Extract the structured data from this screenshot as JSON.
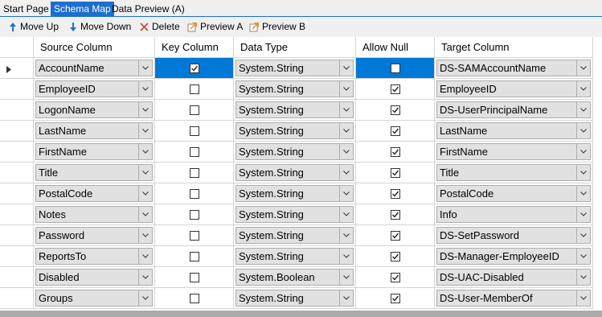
{
  "tabs": [
    {
      "label": "Start Page",
      "active": false
    },
    {
      "label": "Schema Map",
      "active": true
    },
    {
      "label": "Data Preview (A)",
      "active": false
    }
  ],
  "toolbar": [
    {
      "label": "Move Up",
      "icon": "arrow-up-icon",
      "color": "#1e73c8"
    },
    {
      "label": "Move Down",
      "icon": "arrow-down-icon",
      "color": "#1e73c8"
    },
    {
      "label": "Delete",
      "icon": "close-icon",
      "color": "#d83b3b"
    },
    {
      "label": "Preview A",
      "icon": "preview-icon",
      "color": "#e8932a"
    },
    {
      "label": "Preview B",
      "icon": "preview-icon",
      "color": "#e8932a"
    }
  ],
  "columns": [
    "Source Column",
    "Key Column",
    "Data Type",
    "Allow Null",
    "Target Column"
  ],
  "rows": [
    {
      "source": "AccountName",
      "key": true,
      "type": "System.String",
      "nullable": false,
      "target": "DS-SAMAccountName",
      "current": true
    },
    {
      "source": "EmployeeID",
      "key": false,
      "type": "System.String",
      "nullable": true,
      "target": "EmployeeID"
    },
    {
      "source": "LogonName",
      "key": false,
      "type": "System.String",
      "nullable": true,
      "target": "DS-UserPrincipalName"
    },
    {
      "source": "LastName",
      "key": false,
      "type": "System.String",
      "nullable": true,
      "target": "LastName"
    },
    {
      "source": "FirstName",
      "key": false,
      "type": "System.String",
      "nullable": true,
      "target": "FirstName"
    },
    {
      "source": "Title",
      "key": false,
      "type": "System.String",
      "nullable": true,
      "target": "Title"
    },
    {
      "source": "PostalCode",
      "key": false,
      "type": "System.String",
      "nullable": true,
      "target": "PostalCode"
    },
    {
      "source": "Notes",
      "key": false,
      "type": "System.String",
      "nullable": true,
      "target": "Info"
    },
    {
      "source": "Password",
      "key": false,
      "type": "System.String",
      "nullable": true,
      "target": "DS-SetPassword"
    },
    {
      "source": "ReportsTo",
      "key": false,
      "type": "System.String",
      "nullable": true,
      "target": "DS-Manager-EmployeeID"
    },
    {
      "source": "Disabled",
      "key": false,
      "type": "System.Boolean",
      "nullable": true,
      "target": "DS-UAC-Disabled"
    },
    {
      "source": "Groups",
      "key": false,
      "type": "System.String",
      "nullable": true,
      "target": "DS-User-MemberOf"
    }
  ],
  "colors": {
    "accent": "#0078d7",
    "tab_active": "#1c6fd1"
  }
}
